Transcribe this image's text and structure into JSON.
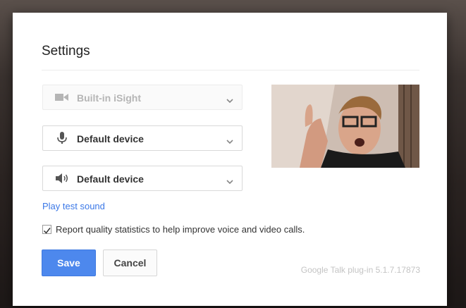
{
  "dialog": {
    "title": "Settings",
    "camera": {
      "selected": "Built-in iSight",
      "icon": "video-camera-icon",
      "disabled": true
    },
    "microphone": {
      "selected": "Default device",
      "icon": "microphone-icon"
    },
    "speaker": {
      "selected": "Default device",
      "icon": "speaker-icon"
    },
    "play_test_sound": "Play test sound",
    "report_stats": {
      "label": "Report quality statistics to help improve voice and video calls.",
      "checked": true
    },
    "save_label": "Save",
    "cancel_label": "Cancel",
    "version": "Google Talk plug-in 5.1.7.17873"
  },
  "colors": {
    "accent": "#4d88ed",
    "link": "#3b78e7"
  }
}
